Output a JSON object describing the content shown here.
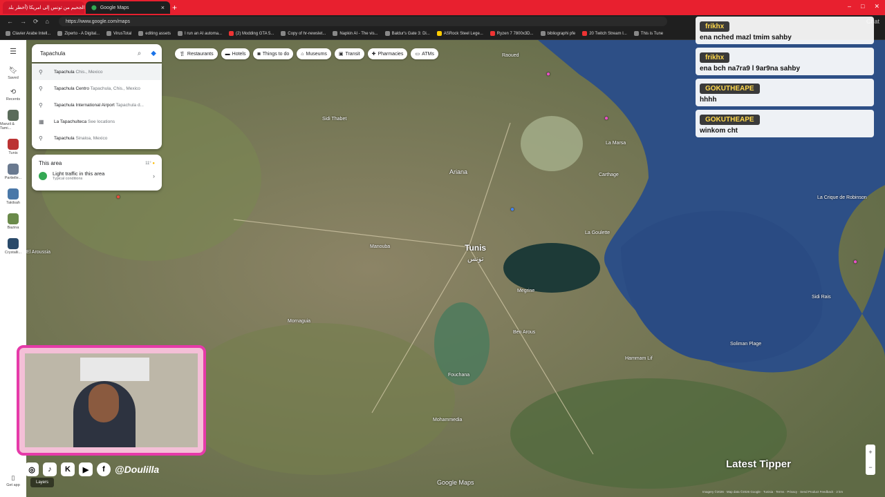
{
  "browser": {
    "tabs": [
      {
        "label": "الجحيم من تونس إلى امريكا (أخطر بلد"
      },
      {
        "label": "Google Maps"
      }
    ],
    "url": "https://www.google.com/maps",
    "bookmarks": [
      "Clavier Arabe Intell...",
      "Ziperto - A Digital...",
      "VirusTotal",
      "editing assets",
      "I run an AI automa...",
      "(2) Modding GTA 5...",
      "Copy of hr-newslet...",
      "Napkin AI - The vis...",
      "Baldur's Gate 3: Di...",
      "ASRock Steel Lege...",
      "Ryzen 7 7800x3D...",
      "bibliographi pfe",
      "20 Twitch Stream I...",
      "This is Tune"
    ],
    "chat_btn": "Chat"
  },
  "sidebar": {
    "items": [
      {
        "label": "Saved"
      },
      {
        "label": "Recents"
      },
      {
        "label": "Manzil & Tami..."
      },
      {
        "label": "Tunis"
      },
      {
        "label": "Partielle..."
      },
      {
        "label": "Takilsah"
      },
      {
        "label": "Bazina"
      },
      {
        "label": "Crystalli..."
      },
      {
        "label": "Get app"
      }
    ]
  },
  "search": {
    "value": "Tapachula",
    "suggestions": [
      {
        "main": "Tapachula",
        "sub": "Chis., Mexico"
      },
      {
        "main": "Tapachula Centro",
        "sub": "Tapachula, Chis., Mexico"
      },
      {
        "main": "Tapachula International Airport",
        "sub": "Tapachula d..."
      },
      {
        "main": "La Tapachulteca",
        "sub": "See locations"
      },
      {
        "main": "Tapachula",
        "sub": "Sinaloa, Mexico"
      }
    ]
  },
  "area": {
    "title": "This area",
    "temp": "11°",
    "traffic": "Light traffic in this area",
    "traffic_sub": "Typical conditions"
  },
  "chips": [
    "Restaurants",
    "Hotels",
    "Things to do",
    "Museums",
    "Transit",
    "Pharmacies",
    "ATMs"
  ],
  "map_labels": [
    {
      "text": "Tunis"
    },
    {
      "text": "تونس"
    },
    {
      "text": "La Marsa"
    },
    {
      "text": "Ariana"
    },
    {
      "text": "Manouba"
    },
    {
      "text": "La Goulette"
    },
    {
      "text": "Megrine"
    },
    {
      "text": "Hammam Lif"
    },
    {
      "text": "Soliman Plage"
    },
    {
      "text": "Sidi Rais"
    },
    {
      "text": "La Crique de Robinson"
    },
    {
      "text": "Carthage"
    },
    {
      "text": "Raoued"
    },
    {
      "text": "El Aroussia"
    },
    {
      "text": "Sidi Thabet"
    },
    {
      "text": "Mornaguia"
    },
    {
      "text": "Fouchana"
    },
    {
      "text": "Mohammedia"
    },
    {
      "text": "Ben Arous"
    }
  ],
  "chat": [
    {
      "user": "frikhx",
      "text": "ena nched mazl tmim sahby"
    },
    {
      "user": "frikhx",
      "text": "ena bch na7ra9 l 9ar9na sahby"
    },
    {
      "user": "GOKUTHEAPE",
      "text": "hhhh"
    },
    {
      "user": "GOKUTHEAPE",
      "text": "winkom cht"
    }
  ],
  "overlay": {
    "handle": "@Doulilla",
    "latest_tipper": "Latest Tipper",
    "layers": "Layers"
  },
  "map_footer": {
    "brand": "Google Maps",
    "credits": "Imagery ©2026 · Map data ©2026 Google · Tunisia · Terms · Privacy · Send Product Feedback · 2 km"
  },
  "colors": {
    "accent": "#1a73e8",
    "titlebar": "#e8202f",
    "cam_border": "#e63aa9"
  }
}
